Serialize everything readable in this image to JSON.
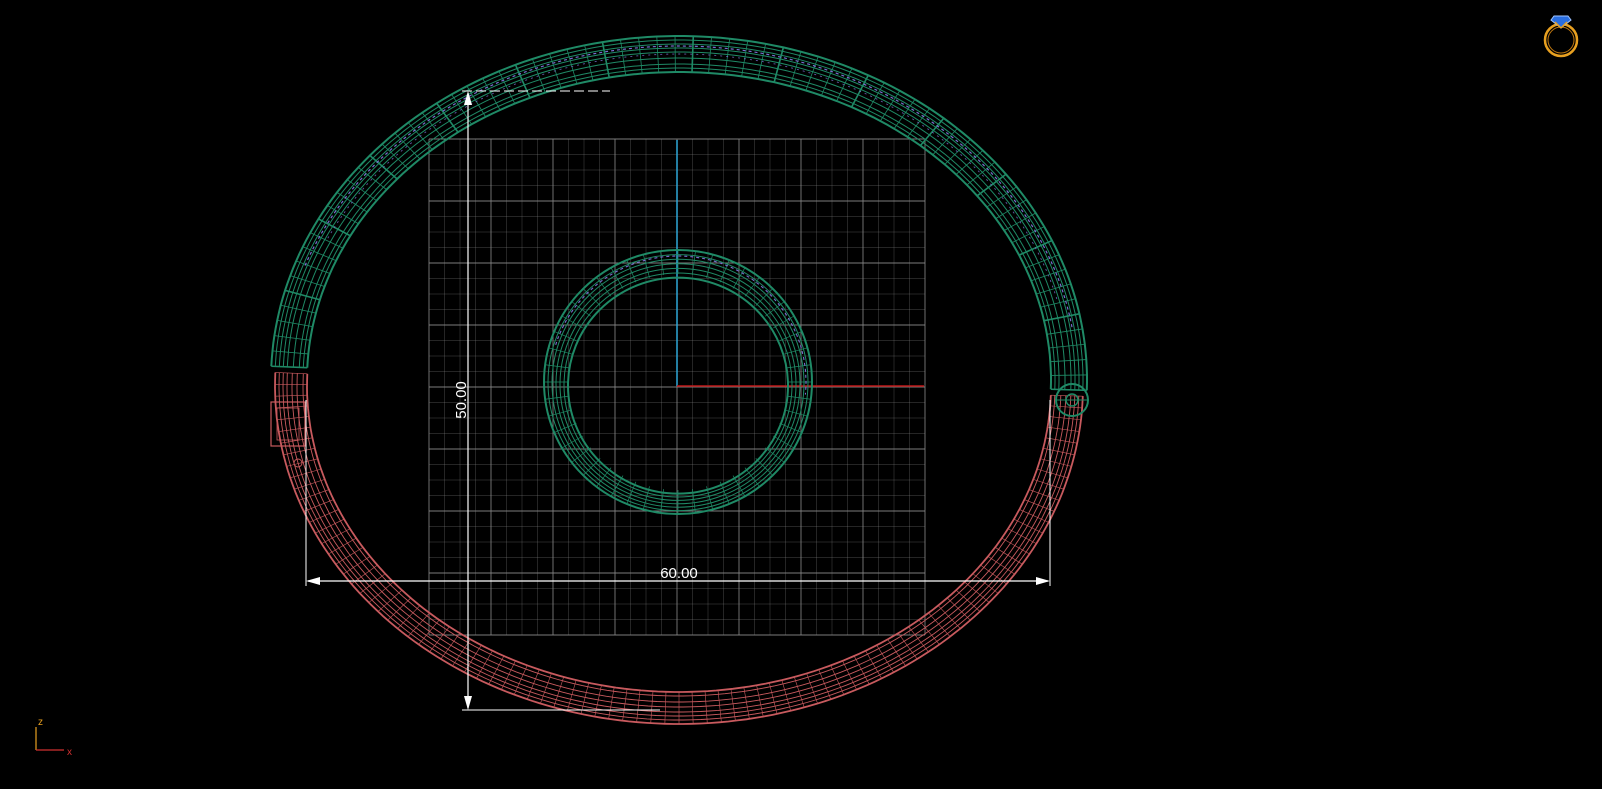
{
  "viewport": {
    "background": "#000000",
    "grid_color": "#8a8a8a",
    "y_axis_color": "#2fa8d8",
    "x_axis_color": "#c01818",
    "upper_body_color": "#1f8a66",
    "lower_body_color": "#c85a5e",
    "stone_color": "#7a6ed0",
    "dimension_color": "#ffffff",
    "view_icon": {
      "name": "ring-icon",
      "ring_color": "#e8a020",
      "gem_color": "#2a6ee0"
    }
  },
  "dimensions": {
    "horizontal": {
      "label": "60.00"
    },
    "vertical": {
      "label": "50.00"
    }
  },
  "axis_indicator": {
    "z_label": "z",
    "x_label": "x",
    "z_color": "#e8a020",
    "x_color": "#d03030"
  }
}
